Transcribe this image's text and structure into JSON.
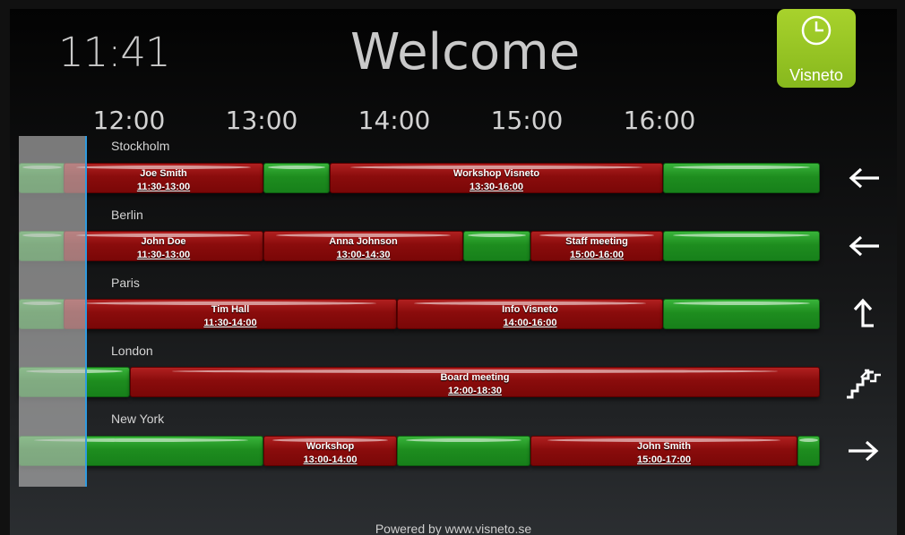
{
  "header": {
    "time": "11:41",
    "title": "Welcome"
  },
  "logo": {
    "text": "Visneto",
    "color": "#99c623"
  },
  "timeline": {
    "hours": [
      "12:00",
      "13:00",
      "14:00",
      "15:00",
      "16:00"
    ]
  },
  "colors": {
    "free": "#1e8d1f",
    "busy": "#8a0c0c",
    "now_line": "#2f9be0"
  },
  "rooms": [
    {
      "name": "Stockholm",
      "status_icon": "arrow-left-icon",
      "bookings": [
        {
          "title": "Joe Smith",
          "time": "11:30-13:00"
        },
        {
          "title": "Workshop Visneto",
          "time": "13:30-16:00"
        }
      ]
    },
    {
      "name": "Berlin",
      "status_icon": "arrow-left-icon",
      "bookings": [
        {
          "title": "John Doe",
          "time": "11:30-13:00"
        },
        {
          "title": "Anna Johnson",
          "time": "13:00-14:30"
        },
        {
          "title": "Staff meeting",
          "time": "15:00-16:00"
        }
      ]
    },
    {
      "name": "Paris",
      "status_icon": "arrow-up-left-icon",
      "bookings": [
        {
          "title": "Tim Hall",
          "time": "11:30-14:00"
        },
        {
          "title": "Info Visneto",
          "time": "14:00-16:00"
        }
      ]
    },
    {
      "name": "London",
      "status_icon": "stairs-icon",
      "bookings": [
        {
          "title": "Board meeting",
          "time": "12:00-18:30"
        }
      ]
    },
    {
      "name": "New York",
      "status_icon": "arrow-right-icon",
      "bookings": [
        {
          "title": "Workshop",
          "time": "13:00-14:00"
        },
        {
          "title": "John Smith",
          "time": "15:00-17:00"
        }
      ]
    }
  ],
  "footer": {
    "text": "Powered by www.visneto.se"
  }
}
